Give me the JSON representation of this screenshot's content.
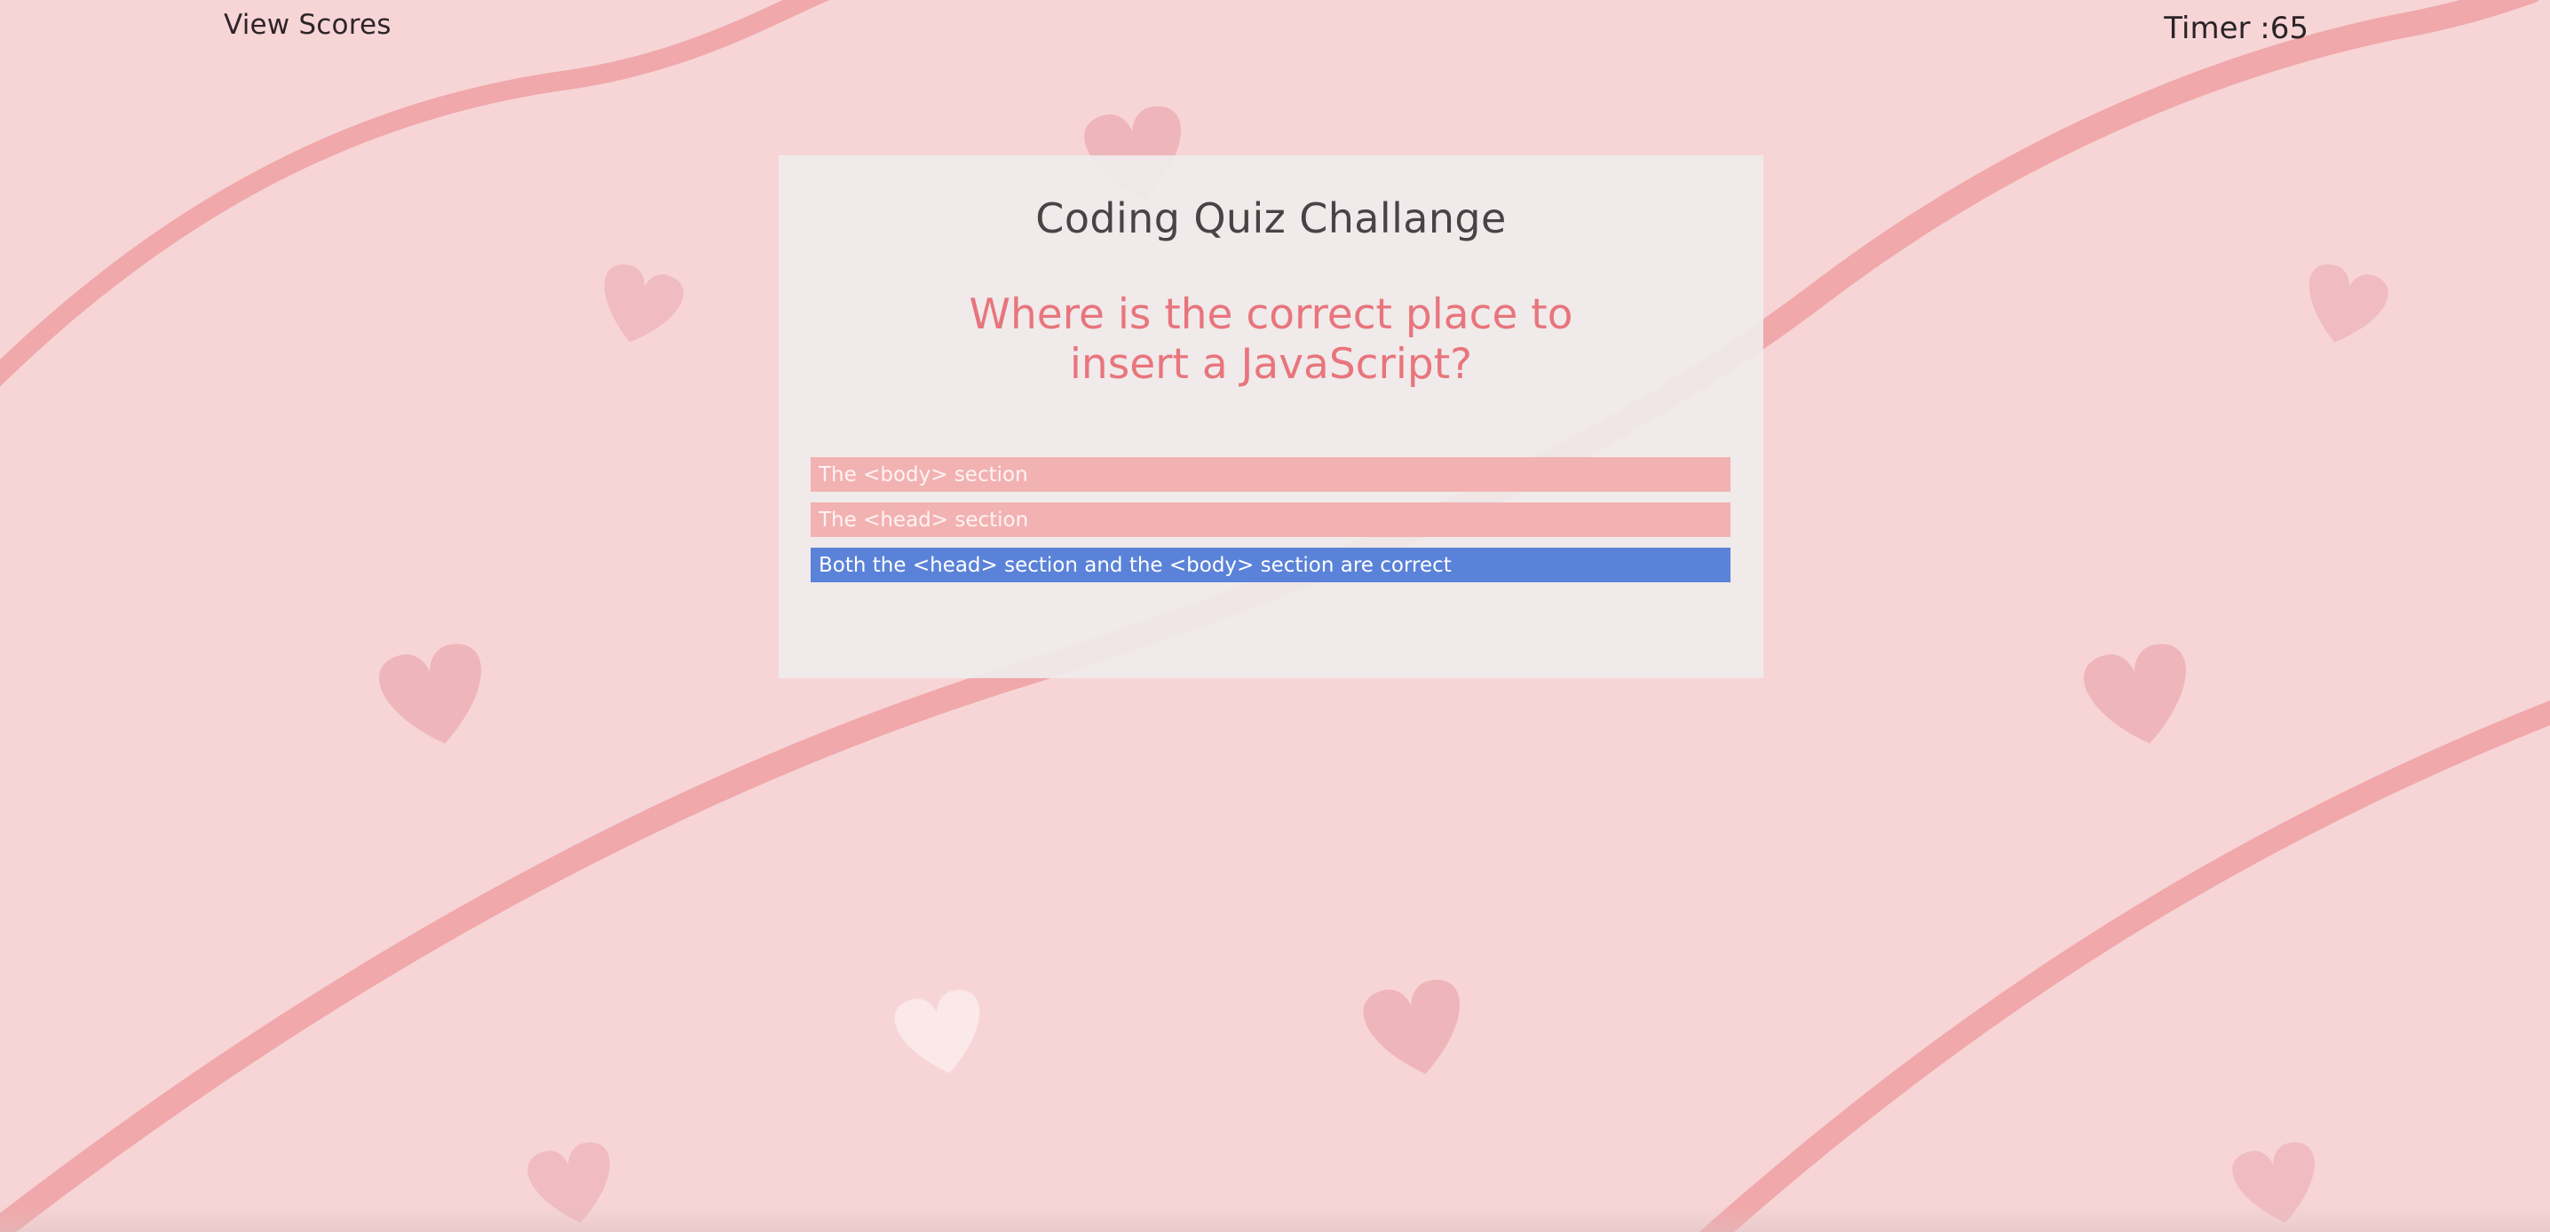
{
  "nav": {
    "view_scores_label": "View Scores"
  },
  "timer": {
    "text": "Timer :65"
  },
  "quiz": {
    "title": "Coding Quiz Challange",
    "question": "Where is the correct place to insert a JavaScript?",
    "choices": [
      {
        "label": "The <body> section",
        "selected": false
      },
      {
        "label": "The <head> section",
        "selected": false
      },
      {
        "label": "Both the <head> section and the <body> section are correct",
        "selected": true
      }
    ]
  },
  "colors": {
    "background": "#f7d5d7",
    "ribbon": "#f0a8aa",
    "heart": "#eeb6bb",
    "card": "#f0ecec",
    "question_text": "#e8757d",
    "choice_default": "#f2b2b2",
    "choice_selected": "#5a82d8"
  },
  "decorations": {
    "background_icons": [
      "heart-icon",
      "ribbon-stripe"
    ]
  }
}
